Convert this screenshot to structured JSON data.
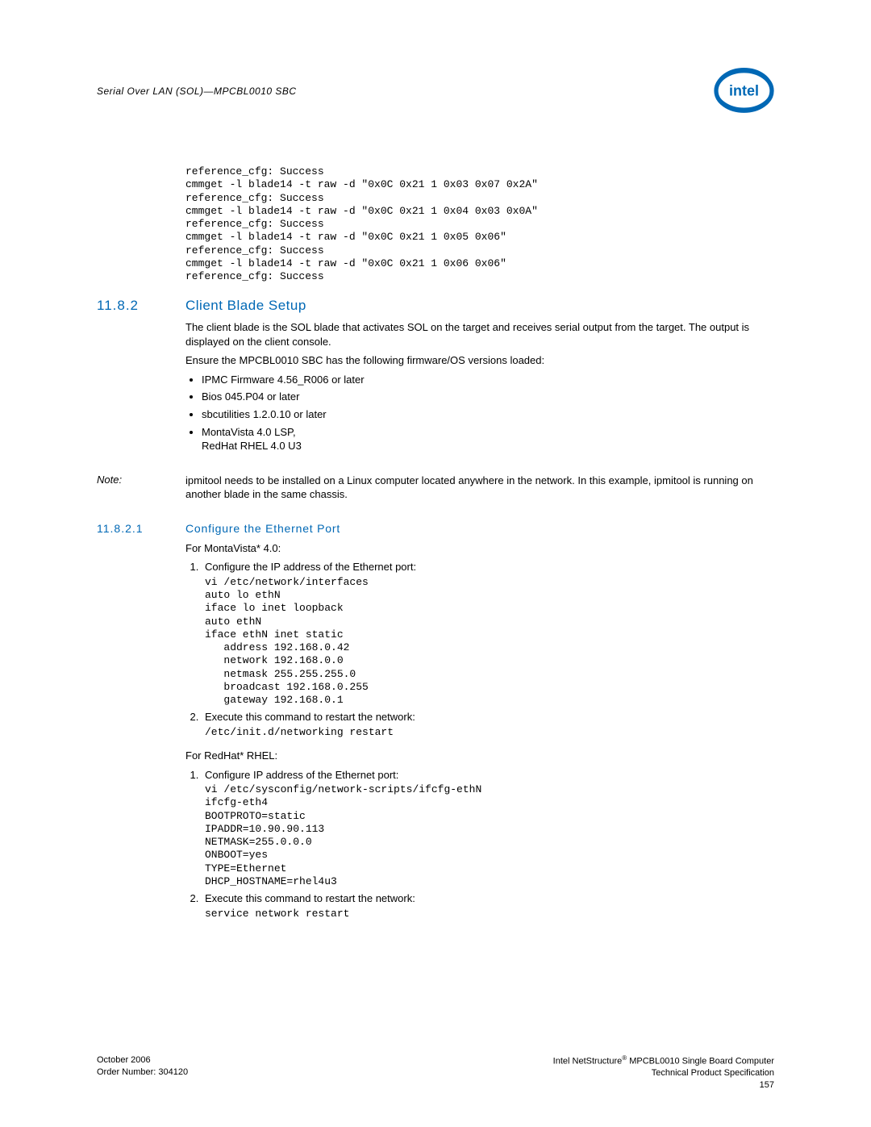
{
  "header": {
    "doc_section": "Serial Over LAN (SOL)—MPCBL0010 SBC",
    "logo_alt": "intel"
  },
  "code_top": "reference_cfg: Success\ncmmget -l blade14 -t raw -d \"0x0C 0x21 1 0x03 0x07 0x2A\"\nreference_cfg: Success\ncmmget -l blade14 -t raw -d \"0x0C 0x21 1 0x04 0x03 0x0A\"\nreference_cfg: Success\ncmmget -l blade14 -t raw -d \"0x0C 0x21 1 0x05 0x06\"\nreference_cfg: Success\ncmmget -l blade14 -t raw -d \"0x0C 0x21 1 0x06 0x06\"\nreference_cfg: Success",
  "section": {
    "num": "11.8.2",
    "title": "Client Blade Setup",
    "para1": "The client blade is the SOL blade that activates SOL on the target and receives serial output from the target. The output is displayed on the client console.",
    "para2": "Ensure the MPCBL0010 SBC has the following firmware/OS versions loaded:",
    "bullets": {
      "b1": "IPMC Firmware 4.56_R006 or later",
      "b2": "Bios 045.P04 or later",
      "b3": "sbcutilities 1.2.0.10 or later",
      "b4": "MontaVista 4.0 LSP,",
      "b4b": "RedHat RHEL 4.0 U3"
    }
  },
  "note": {
    "label": "Note:",
    "body": "ipmitool needs to be installed on a Linux computer located anywhere in the network. In this example, ipmitool is running on another blade in the same chassis."
  },
  "subsection": {
    "num": "11.8.2.1",
    "title": "Configure the Ethernet Port",
    "mv_label": "For MontaVista* 4.0:",
    "mv_step1": "Configure the IP address of the Ethernet port:",
    "mv_code1": "vi /etc/network/interfaces\nauto lo ethN\niface lo inet loopback\nauto ethN\niface ethN inet static\n   address 192.168.0.42\n   network 192.168.0.0\n   netmask 255.255.255.0\n   broadcast 192.168.0.255\n   gateway 192.168.0.1",
    "mv_step2": "Execute this command to restart the network:",
    "mv_code2": "/etc/init.d/networking restart",
    "rh_label": "For RedHat* RHEL:",
    "rh_step1": "Configure IP address of the Ethernet port:",
    "rh_code1": "vi /etc/sysconfig/network-scripts/ifcfg-ethN\nifcfg-eth4\nBOOTPROTO=static\nIPADDR=10.90.90.113\nNETMASK=255.0.0.0\nONBOOT=yes\nTYPE=Ethernet\nDHCP_HOSTNAME=rhel4u3",
    "rh_step2": "Execute this command to restart the network:",
    "rh_code2": "service network restart"
  },
  "footer": {
    "left1": "October 2006",
    "left2": "Order Number: 304120",
    "right1a": "Intel NetStructure",
    "right1b": " MPCBL0010 Single Board Computer",
    "right2": "Technical Product Specification",
    "right3": "157"
  }
}
